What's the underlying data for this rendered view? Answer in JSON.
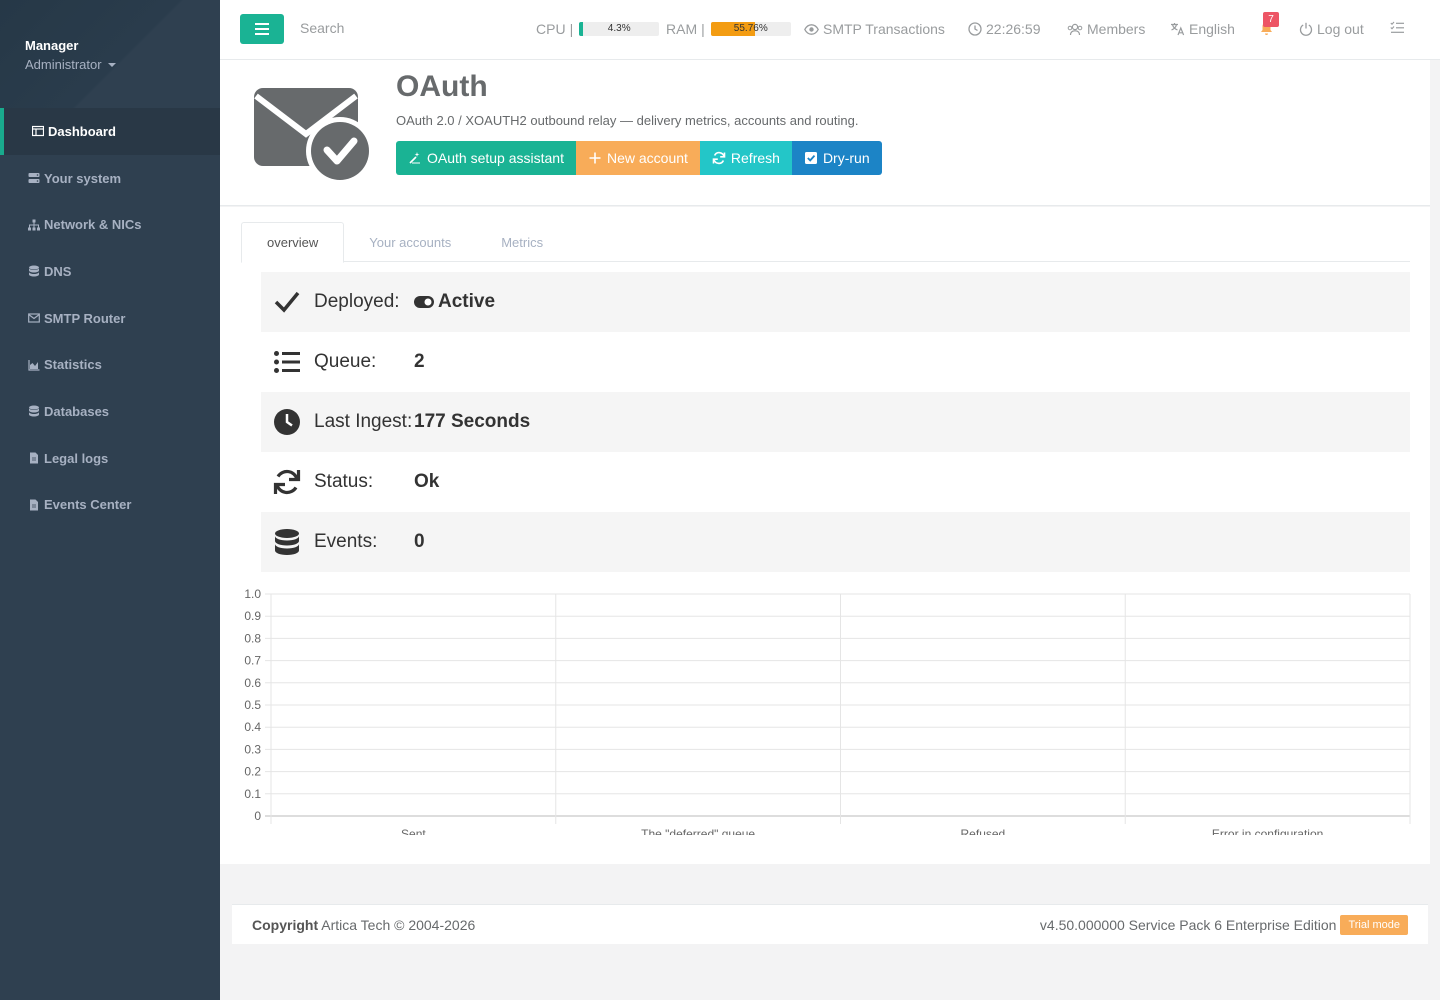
{
  "sidebar": {
    "user_name": "Manager",
    "user_role": "Administrator",
    "items": [
      {
        "label": "Dashboard",
        "icon": "table-icon"
      },
      {
        "label": "Your system",
        "icon": "server-icon"
      },
      {
        "label": "Network & NICs",
        "icon": "sitemap-icon"
      },
      {
        "label": "DNS",
        "icon": "database-icon"
      },
      {
        "label": "SMTP Router",
        "icon": "envelope-icon"
      },
      {
        "label": "Statistics",
        "icon": "area-chart-icon"
      },
      {
        "label": "Databases",
        "icon": "database-icon"
      },
      {
        "label": "Legal logs",
        "icon": "file-icon"
      },
      {
        "label": "Events Center",
        "icon": "file-icon"
      }
    ]
  },
  "topbar": {
    "search_placeholder": "Search",
    "cpu_label": "CPU",
    "cpu_value": "4.3%",
    "cpu_percent": 4.3,
    "ram_label": "RAM",
    "ram_value": "55.76%",
    "ram_percent": 55.76,
    "smtp_label": "SMTP Transactions",
    "clock": "22:26:59",
    "members_label": "Members",
    "language": "English",
    "notification_count": "7",
    "logout_label": "Log out"
  },
  "page": {
    "title": "OAuth",
    "subtitle": "OAuth 2.0 / XOAUTH2 outbound relay — delivery metrics, accounts and routing.",
    "buttons": {
      "setup": "OAuth setup assistant",
      "new_account": "New account",
      "refresh": "Refresh",
      "dry_run": "Dry-run"
    }
  },
  "tabs": [
    "overview",
    "Your accounts",
    "Metrics"
  ],
  "info": [
    {
      "label": "Deployed:",
      "value": "Active"
    },
    {
      "label": "Queue:",
      "value": "2"
    },
    {
      "label": "Last Ingest:",
      "value": "177 Seconds"
    },
    {
      "label": "Status:",
      "value": "Ok"
    },
    {
      "label": "Events:",
      "value": "0"
    }
  ],
  "chart_data": {
    "type": "bar",
    "categories": [
      "Sent",
      "The \"deferred\" queue",
      "Refused",
      "Error in configuration"
    ],
    "values": [
      0,
      0,
      0,
      0
    ],
    "ylim": [
      0,
      1
    ],
    "yticks": [
      "0",
      "0.1",
      "0.2",
      "0.3",
      "0.4",
      "0.5",
      "0.6",
      "0.7",
      "0.8",
      "0.9",
      "1.0"
    ],
    "grid": true
  },
  "footer": {
    "copyright_label": "Copyright",
    "copyright_text": "Artica Tech © 2004-2026",
    "version": "v4.50.000000 Service Pack 6 Enterprise Edition",
    "trial": "Trial mode"
  },
  "colors": {
    "sidebar_bg": "#2f4050",
    "primary": "#1ab394",
    "warning": "#f8ac59",
    "info": "#23c6c8",
    "blue": "#1c84c6",
    "cpu_fill": "#1ab394",
    "ram_fill": "#f39c12"
  }
}
